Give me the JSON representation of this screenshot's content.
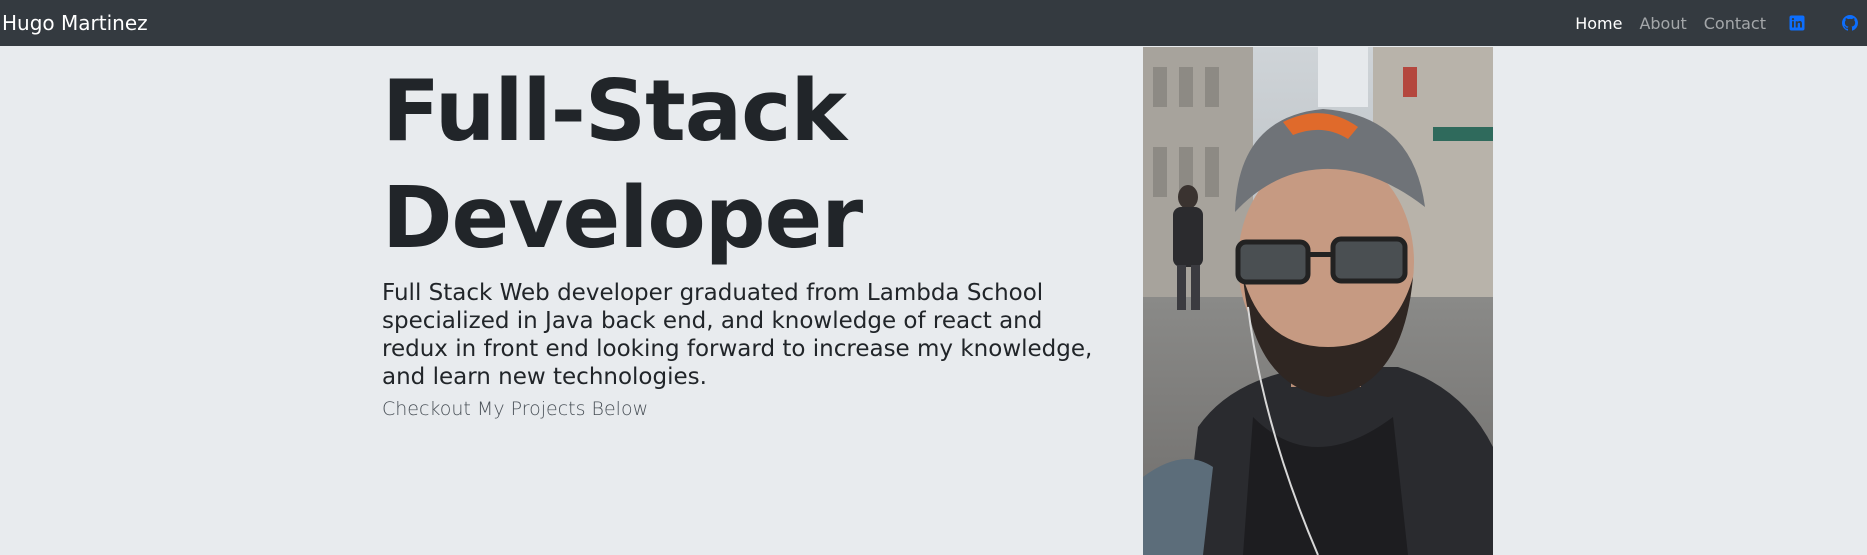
{
  "navbar": {
    "brand": "Hugo Martinez",
    "links": [
      {
        "label": "Home",
        "active": true
      },
      {
        "label": "About",
        "active": false
      },
      {
        "label": "Contact",
        "active": false
      }
    ],
    "social": [
      {
        "icon": "linkedin-icon",
        "color": "#0d6efd"
      },
      {
        "icon": "github-icon",
        "color": "#0d6efd"
      }
    ],
    "background": "#343a40"
  },
  "hero": {
    "title_line1": "Full-Stack",
    "title_line2": "Developer",
    "description": "Full Stack Web developer graduated from Lambda School specialized in Java back end, and knowledge of react and redux in front end looking forward to increase my knowledge, and learn new technologies.",
    "subtitle": "Checkout My Projects Below"
  },
  "portrait": {
    "icon": "profile-photo"
  },
  "theme": {
    "page_background": "#e8ebee",
    "text": "#212529",
    "link_accent": "#0d6efd"
  }
}
